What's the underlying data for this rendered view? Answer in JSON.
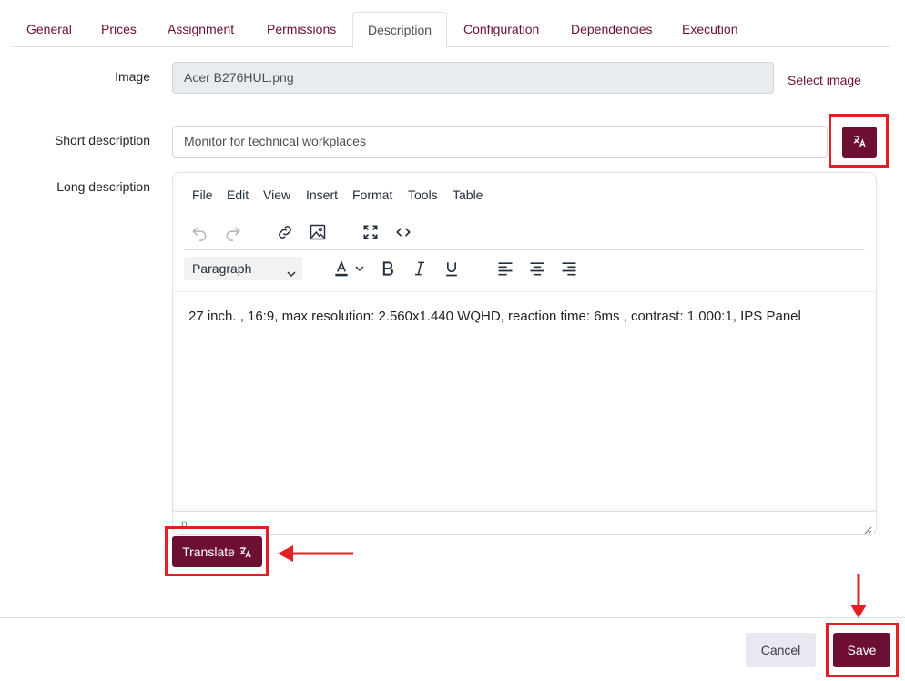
{
  "tabs": [
    {
      "label": "General",
      "active": false
    },
    {
      "label": "Prices",
      "active": false
    },
    {
      "label": "Assignment",
      "active": false
    },
    {
      "label": "Permissions",
      "active": false
    },
    {
      "label": "Description",
      "active": true
    },
    {
      "label": "Configuration",
      "active": false
    },
    {
      "label": "Dependencies",
      "active": false
    },
    {
      "label": "Execution",
      "active": false
    }
  ],
  "form": {
    "image_label": "Image",
    "image_value": "Acer B276HUL.png",
    "select_image_link": "Select image",
    "short_description_label": "Short description",
    "short_description_value": "Monitor for technical workplaces",
    "translate_icon": "translate-icon",
    "long_description_label": "Long description"
  },
  "editor": {
    "menu": [
      "File",
      "Edit",
      "View",
      "Insert",
      "Format",
      "Tools",
      "Table"
    ],
    "toolbar_icons": [
      "undo-icon",
      "redo-icon",
      "link-icon",
      "image-icon",
      "fullscreen-icon",
      "code-icon"
    ],
    "format_icons": [
      "text-color-icon",
      "bold-icon",
      "italic-icon",
      "underline-icon",
      "align-left-icon",
      "align-center-icon",
      "align-right-icon"
    ],
    "block_format": "Paragraph",
    "content": "27 inch. , 16:9, max resolution: 2.560x1.440 WQHD, reaction time: 6ms , contrast: 1.000:1, IPS Panel",
    "status_path": "p"
  },
  "buttons": {
    "translate": "Translate",
    "cancel": "Cancel",
    "save": "Save"
  },
  "colors": {
    "brand": "#6d0f35",
    "annotation": "#e31e24"
  }
}
